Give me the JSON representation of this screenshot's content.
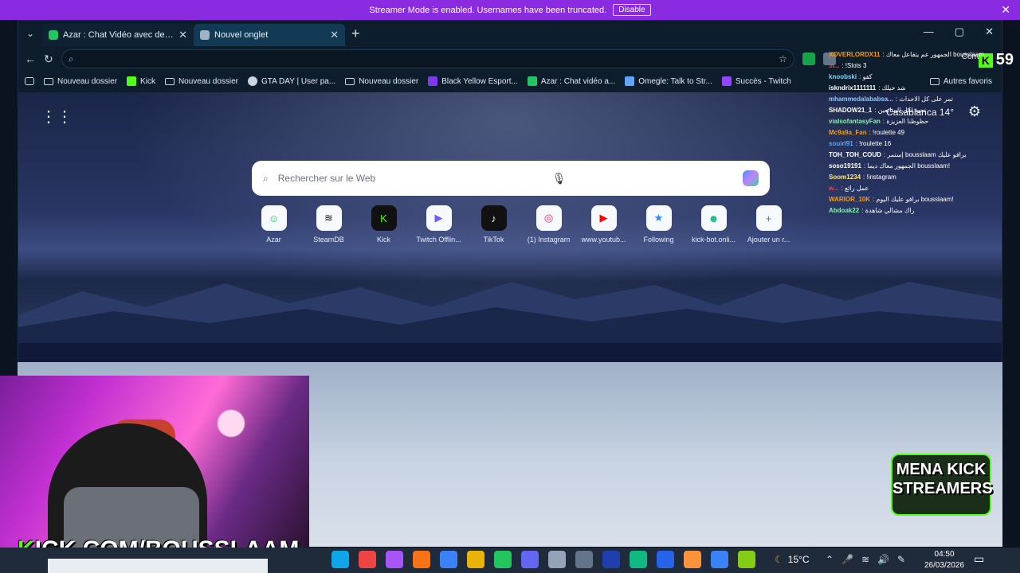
{
  "banner": {
    "text": "Streamer Mode is enabled. Usernames have been truncated.",
    "disable_label": "Disable",
    "close": "✕"
  },
  "tabs": [
    {
      "title": "Azar : Chat Vidéo avec de nou",
      "close": "✕",
      "icon_color": "#22c55e"
    },
    {
      "title": "Nouvel onglet",
      "close": "✕",
      "icon_color": "#9fb3c8"
    }
  ],
  "tab_menu": "⌄",
  "new_tab": "+",
  "window_controls": {
    "minimize": "—",
    "maximize": "▢",
    "close": "✕"
  },
  "nav": {
    "back": "←",
    "refresh": "↻",
    "address_placeholder": "",
    "star": "☆"
  },
  "bookmarks": [
    {
      "label": "Nouveau dossier",
      "kind": "folder"
    },
    {
      "label": "Kick",
      "kind": "site",
      "color": "#53fc18"
    },
    {
      "label": "Nouveau dossier",
      "kind": "folder"
    },
    {
      "label": "GTA DAY | User pa...",
      "kind": "site",
      "color": "#cbd5e1"
    },
    {
      "label": "Nouveau dossier",
      "kind": "folder"
    },
    {
      "label": "Black Yellow Esport...",
      "kind": "site",
      "color": "#7c3aed"
    },
    {
      "label": "Azar : Chat vidéo a...",
      "kind": "site",
      "color": "#22c55e"
    },
    {
      "label": "Omegle: Talk to Str...",
      "kind": "site",
      "color": "#60a5fa"
    },
    {
      "label": "Succès - Twitch",
      "kind": "site",
      "color": "#9146ff"
    }
  ],
  "bookmarks_right": "Autres favoris",
  "ntp": {
    "search_placeholder": "Rechercher sur le Web",
    "weather": "Casablanca 14°",
    "shortcuts": [
      {
        "label": "Azar",
        "glyph": "☺",
        "color": "#22c55e"
      },
      {
        "label": "SteamDB",
        "glyph": "≋",
        "color": "#111111"
      },
      {
        "label": "Kick",
        "glyph": "K",
        "color": "#53fc18"
      },
      {
        "label": "Twitch Offlin...",
        "glyph": "▶",
        "color": "#6d5dfc"
      },
      {
        "label": "TikTok",
        "glyph": "♪",
        "color": "#111111"
      },
      {
        "label": "(1) Instagram",
        "glyph": "◎",
        "color": "#e1306c"
      },
      {
        "label": "www.youtub...",
        "glyph": "▶",
        "color": "#ff0000"
      },
      {
        "label": "Following",
        "glyph": "★",
        "color": "#3b82f6"
      },
      {
        "label": "kick-bot.onli...",
        "glyph": "☻",
        "color": "#10b981"
      },
      {
        "label": "Ajouter un r...",
        "glyph": "+",
        "color": "#6b7280"
      }
    ]
  },
  "chat": {
    "viewer_count": "59",
    "conversations_label": "Convers",
    "messages": [
      {
        "user": "XOVERLORDX11",
        "text": ": الجمهور عم يتفاعل معاك bousslaam",
        "color": "#f59e0b"
      },
      {
        "user": "5i...",
        "text": ": !Slots 3",
        "color": "#ef4444"
      },
      {
        "user": "knoobski",
        "text": ": كفو",
        "color": "#7dd3fc"
      },
      {
        "user": "iskndrix1111111",
        "text": ": شد حيلك",
        "color": "#ffffff"
      },
      {
        "user": "mhammedalababsa...",
        "text": ": تمر على كل الاحداث",
        "color": "#93c5fd"
      },
      {
        "user": "SHADOW21_1",
        "text": ": تحية لكل المتابعين",
        "color": "#ffffff"
      },
      {
        "user": "vialsofantasyFan",
        "text": ": حظوظنا العزيزة",
        "color": "#86efac"
      },
      {
        "user": "Mc9a9a_Fan",
        "text": ": !roulette 49",
        "color": "#f59e0b"
      },
      {
        "user": "souiri91",
        "text": ": !roulette 16",
        "color": "#60a5fa"
      },
      {
        "user": "TOH_TOH_COUD",
        "text": ": إستمر bousslaam برافو عليك",
        "color": "#ffffff"
      },
      {
        "user": "soso19191",
        "text": ": الجمهور معاك ديما bousslaam!",
        "color": "#ffffff"
      },
      {
        "user": "Soom1234",
        "text": ": !instagram",
        "color": "#fde68a"
      },
      {
        "user": "w...",
        "text": ": عمل رائع",
        "color": "#ef4444"
      },
      {
        "user": "WARIOR_10K",
        "text": ": برافو عليك اليوم bousslaam!",
        "color": "#f59e0b"
      },
      {
        "user": "Abdoak22",
        "text": ": راك مشالي شاهدة",
        "color": "#86efac"
      }
    ]
  },
  "overlay": {
    "kick_url_k": "K",
    "kick_url_rest": "ICK.COM/BOUSSLAAM",
    "mena_line1": "MENA KICK",
    "mena_line2": "STREAMERS"
  },
  "taskbar": {
    "icon_colors": [
      "#0ea5e9",
      "#ef4444",
      "#a855f7",
      "#f97316",
      "#3b82f6",
      "#eab308",
      "#22c55e",
      "#6366f1",
      "#94a3b8",
      "#64748b",
      "#1e40af",
      "#10b981",
      "#2563eb",
      "#fb923c",
      "#3b82f6",
      "#84cc16"
    ],
    "temperature": "15°C",
    "time": "04:50",
    "date": "26/03/2026"
  }
}
